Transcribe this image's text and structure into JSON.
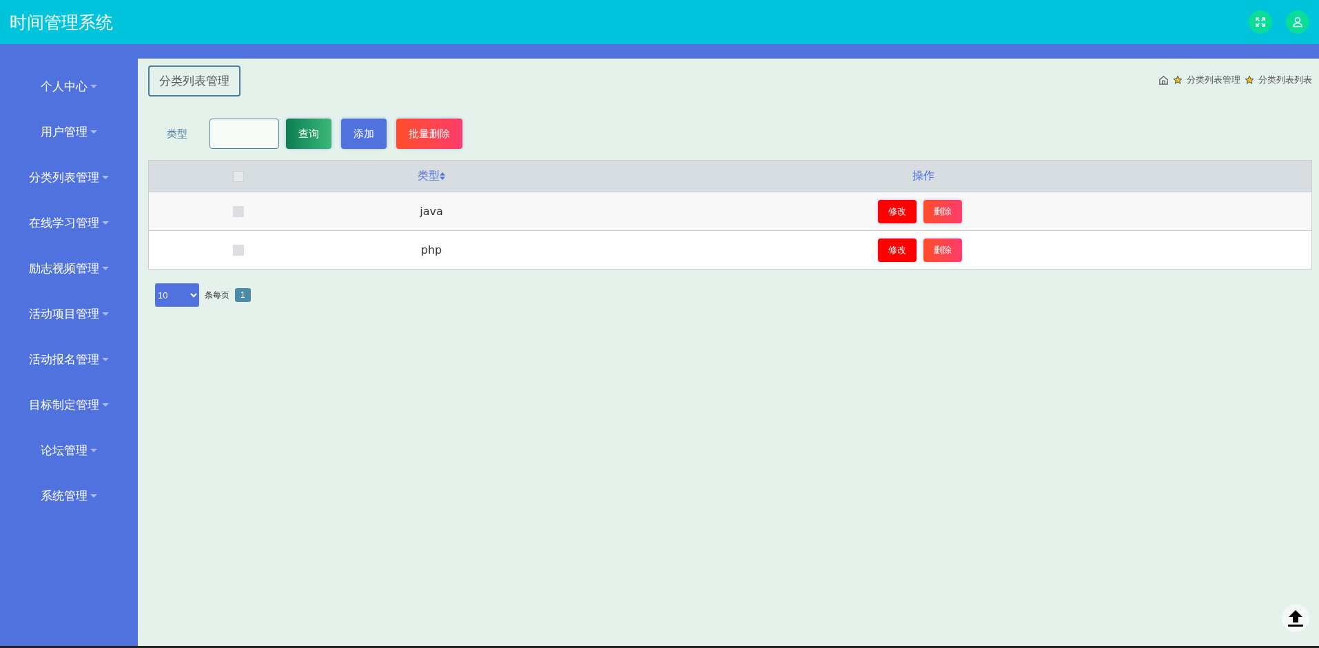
{
  "header": {
    "title": "时间管理系统"
  },
  "sidebar": {
    "items": [
      {
        "label": "个人中心",
        "expanded": false
      },
      {
        "label": "用户管理",
        "expanded": false
      },
      {
        "label": "分类列表管理",
        "expanded": false
      },
      {
        "label": "在线学习管理",
        "expanded": false
      },
      {
        "label": "励志视频管理",
        "expanded": false
      },
      {
        "label": "活动项目管理",
        "expanded": false
      },
      {
        "label": "活动报名管理",
        "expanded": false
      },
      {
        "label": "目标制定管理",
        "expanded": false
      },
      {
        "label": "论坛管理",
        "expanded": false
      },
      {
        "label": "系统管理",
        "expanded": false
      }
    ]
  },
  "page_title": "分类列表管理",
  "breadcrumb": [
    "分类列表管理",
    "分类列表列表"
  ],
  "search": {
    "label": "类型",
    "buttons": [
      {
        "label": "查询",
        "kind": "search"
      },
      {
        "label": "添加",
        "kind": "add"
      },
      {
        "label": "批量删除",
        "kind": "delete"
      }
    ]
  },
  "table": {
    "header_checked": false,
    "columns": [
      "类型",
      "操作"
    ],
    "rows": [
      {
        "checked": false,
        "type": "java",
        "actions": [
          {
            "label": "修改",
            "kind": "edit"
          },
          {
            "label": "删除",
            "kind": "delete"
          }
        ]
      },
      {
        "checked": false,
        "type": "php",
        "actions": [
          {
            "label": "修改",
            "kind": "edit"
          },
          {
            "label": "删除",
            "kind": "delete"
          }
        ]
      }
    ]
  },
  "pagination": {
    "page_size": "10",
    "per_page_label": "条每页",
    "pages": [
      {
        "label": "1",
        "selected": true
      }
    ]
  }
}
